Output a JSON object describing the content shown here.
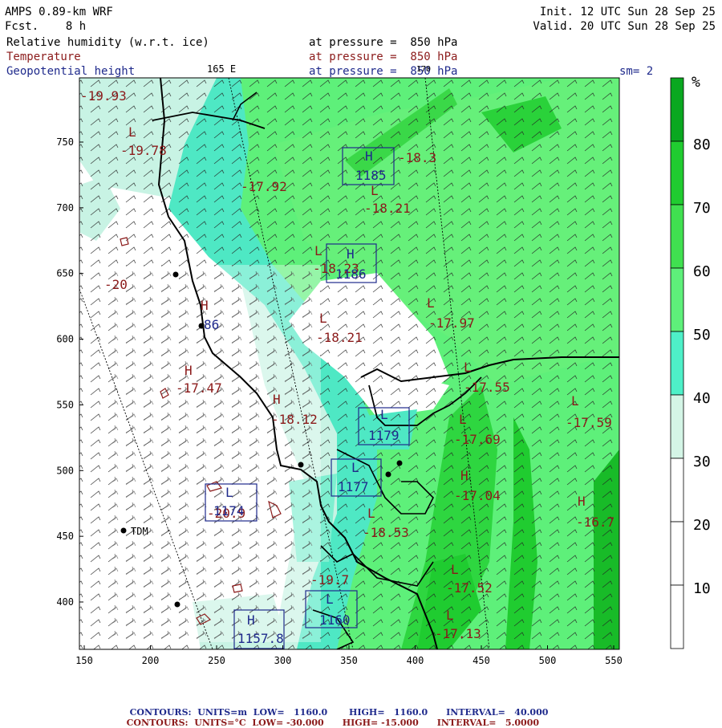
{
  "header": {
    "model": "AMPS 0.89-km WRF",
    "fcst": "Fcst.    8 h",
    "init": "Init. 12 UTC Sun 28 Sep 25",
    "valid": "Valid. 20 UTC Sun 28 Sep 25",
    "field1_name": "Relative humidity (w.r.t. ice)",
    "field2_name": "Temperature",
    "field3_name": "Geopotential height",
    "pressure1": "at pressure =  850 hPa",
    "pressure2": "at pressure =  850 hPa",
    "pressure3": "at pressure =  850 hPa",
    "lon_165e": "165 E",
    "lon_170": "170",
    "smoothing": "sm= 2"
  },
  "colorbar": {
    "unit": "%",
    "labels": [
      "80",
      "70",
      "60",
      "50",
      "40",
      "30",
      "20",
      "10"
    ],
    "colors": [
      "#ffffff",
      "#ffffff",
      "#ffffff",
      "#d4f5e6",
      "#4ef0c8",
      "#5ef07a",
      "#40e050",
      "#20cc30",
      "#0aa820"
    ]
  },
  "axes": {
    "x_ticks": [
      "150",
      "200",
      "250",
      "300",
      "350",
      "400",
      "450",
      "500",
      "550"
    ],
    "y_ticks": [
      "750",
      "700",
      "650",
      "600",
      "550",
      "500",
      "450",
      "400"
    ]
  },
  "station": {
    "name": "TDM"
  },
  "temperature_labels": [
    "-19.93",
    "-19.78",
    "-17.92",
    "-18.3",
    "-18.21",
    "-18.23",
    "-18.21",
    "-17.97",
    "-20",
    "-17.47",
    "-18.12",
    "-17.55",
    "-17.59",
    "-17.69",
    "-17.04",
    "-18.53",
    "-20.9",
    "-19.7",
    "-17.52",
    "-17.13",
    "-16.7"
  ],
  "height_labels": [
    "1185",
    "1186",
    "86",
    "1179",
    "1177",
    "1174",
    "1160",
    "1157.8"
  ],
  "contour_marks": [
    "L",
    "H"
  ],
  "footer": {
    "line1": {
      "prefix": "CONTOURS:",
      "units": "UNITS=m",
      "low": "LOW=   1160.0",
      "high": "HIGH=   1160.0",
      "interval": "INTERVAL=   40.000"
    },
    "line2": {
      "prefix": "CONTOURS:",
      "units": "UNITS=°C",
      "low": "LOW= -30.000",
      "high": "HIGH= -15.000",
      "interval": "INTERVAL=   5.0000"
    }
  }
}
